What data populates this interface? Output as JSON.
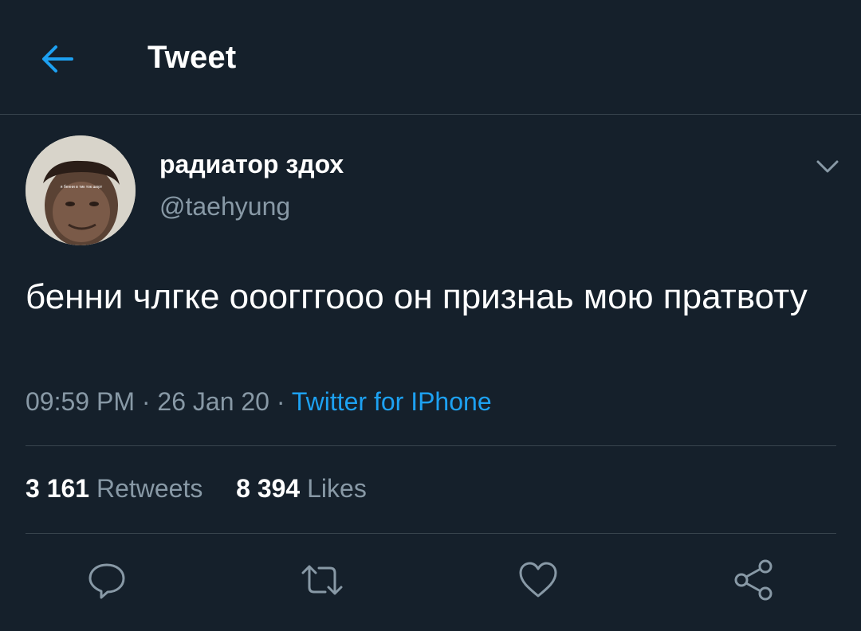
{
  "header": {
    "title": "Tweet",
    "back_icon": "arrow-left-icon",
    "accent_color": "#1da1f2"
  },
  "tweet": {
    "author": {
      "display_name": "радиатор здох",
      "handle": "@taehyung",
      "avatar_caption": "я бенни в тик ток шорт"
    },
    "text": "бенни члгке ооогггооо он признаь мою пратвоту",
    "time": "09:59 PM",
    "date": "26 Jan 20",
    "separator": "·",
    "source": "Twitter for IPhone",
    "stats": {
      "retweets_count": "3 161",
      "retweets_label": "Retweets",
      "likes_count": "8 394",
      "likes_label": "Likes"
    },
    "actions": [
      "reply-icon",
      "retweet-icon",
      "like-icon",
      "share-icon"
    ]
  },
  "colors": {
    "background": "#15202b",
    "border": "#38444d",
    "secondary_text": "#8899a6",
    "link": "#1da1f2"
  }
}
